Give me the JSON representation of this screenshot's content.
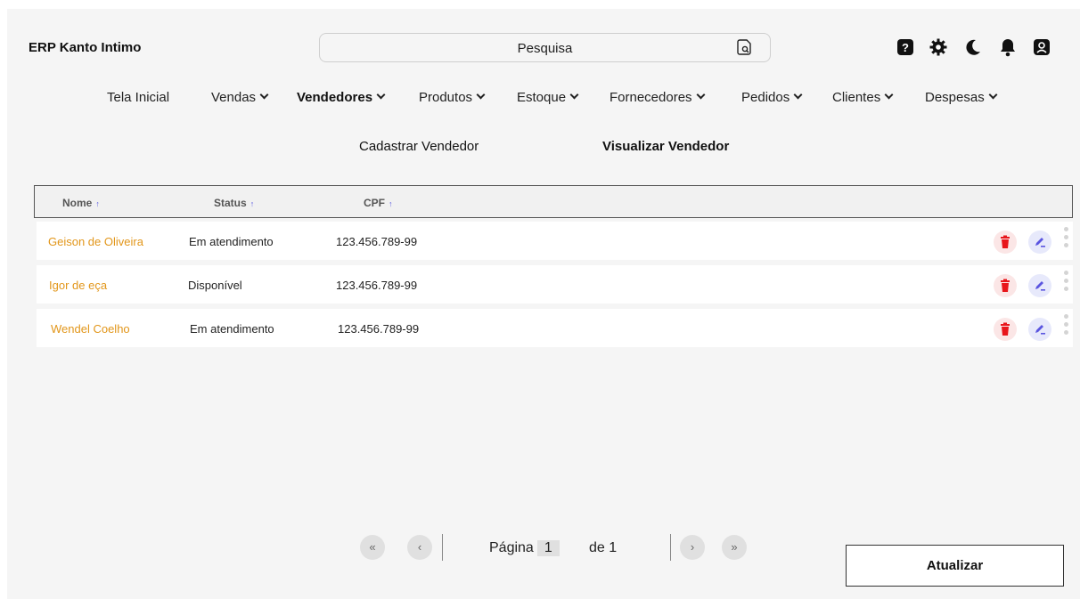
{
  "app": {
    "title": "ERP Kanto Intimo"
  },
  "search": {
    "placeholder": "Pesquisa"
  },
  "top_icons": [
    "help-icon",
    "gear-icon",
    "moon-icon",
    "bell-icon",
    "user-icon"
  ],
  "nav": {
    "items": [
      {
        "label": "Tela Inicial",
        "has_menu": false
      },
      {
        "label": "Vendas",
        "has_menu": true
      },
      {
        "label": "Vendedores",
        "has_menu": true,
        "active": true
      },
      {
        "label": "Produtos",
        "has_menu": true
      },
      {
        "label": "Estoque",
        "has_menu": true
      },
      {
        "label": "Fornecedores",
        "has_menu": true
      },
      {
        "label": "Pedidos",
        "has_menu": true
      },
      {
        "label": "Clientes",
        "has_menu": true
      },
      {
        "label": "Despesas",
        "has_menu": true
      }
    ]
  },
  "subnav": {
    "items": [
      {
        "label": "Cadastrar Vendedor",
        "active": false
      },
      {
        "label": "Visualizar Vendedor",
        "active": true
      }
    ]
  },
  "table": {
    "columns": [
      "Nome",
      "Status",
      "CPF"
    ],
    "rows": [
      {
        "name": "Geison de Oliveira",
        "status": "Em atendimento",
        "cpf": "123.456.789-99"
      },
      {
        "name": "Igor de eça",
        "status": "Disponível",
        "cpf": "123.456.789-99"
      },
      {
        "name": "Wendel Coelho",
        "status": "Em atendimento",
        "cpf": "123.456.789-99"
      }
    ]
  },
  "pagination": {
    "page_label": "Página",
    "current": "1",
    "of_label": "de 1"
  },
  "refresh_label": "Atualizar",
  "colors": {
    "name_text": "#e2961a",
    "delete_icon": "#e8161b",
    "edit_icon": "#5a55e0"
  }
}
